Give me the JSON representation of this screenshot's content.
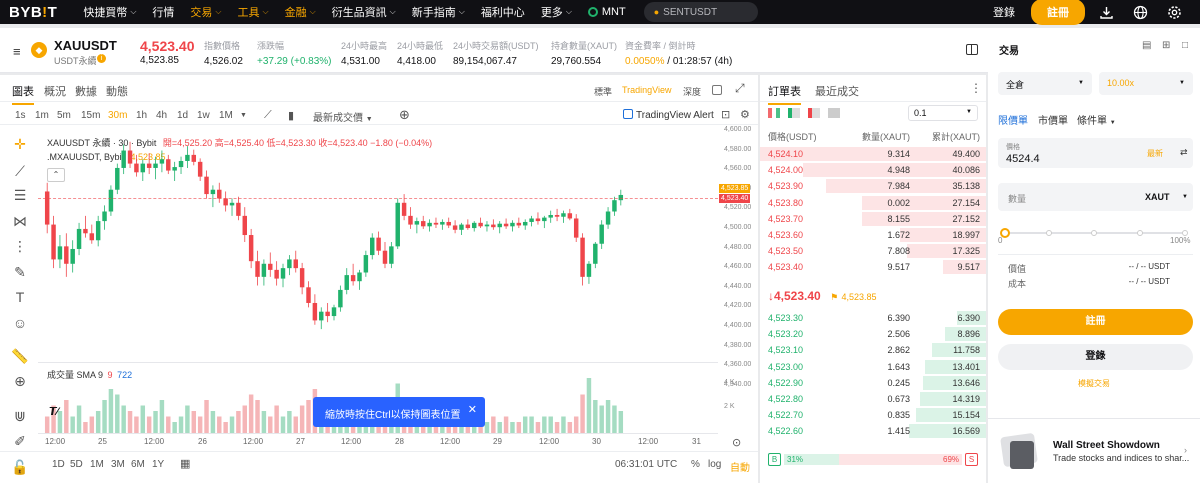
{
  "nav": {
    "logo_a": "BYB",
    "logo_b": "!",
    "logo_c": "T",
    "items": [
      {
        "label": "快捷買幣",
        "caret": true,
        "orange": false
      },
      {
        "label": "行情",
        "caret": false,
        "orange": false
      },
      {
        "label": "交易",
        "caret": true,
        "orange": true
      },
      {
        "label": "工具",
        "caret": true,
        "orange": true
      },
      {
        "label": "金融",
        "caret": true,
        "orange": true
      },
      {
        "label": "衍生品資訊",
        "caret": true,
        "orange": false
      },
      {
        "label": "新手指南",
        "caret": true,
        "orange": false
      },
      {
        "label": "福利中心",
        "caret": false,
        "orange": false
      },
      {
        "label": "更多",
        "caret": true,
        "orange": false
      },
      {
        "label": "MNT",
        "caret": false,
        "orange": false
      }
    ],
    "search_placeholder": "SENTUSDT",
    "login": "登錄",
    "register": "註冊"
  },
  "ticker": {
    "symbol": "XAUUSDT",
    "sub": "USDT永續",
    "last": "4,523.40",
    "last_sub": "4,523.85",
    "stats": [
      {
        "label": "指數價格",
        "value": "4,526.02",
        "color": "#121214"
      },
      {
        "label": "漲跌幅",
        "value": "+37.29 (+0.83%)",
        "color": "#20b26c"
      },
      {
        "label": "24小時最高",
        "value": "4,531.00",
        "color": "#121214"
      },
      {
        "label": "24小時最低",
        "value": "4,418.00",
        "color": "#121214"
      },
      {
        "label": "24小時交易額(USDT)",
        "value": "89,154,067.47",
        "color": "#121214"
      },
      {
        "label": "持倉數量(XAUT)",
        "value": "29,760.554",
        "color": "#121214"
      }
    ],
    "funding_label": "資金費率 / 倒計時",
    "funding_rate": "0.0050%",
    "funding_countdown": " / 01:28:57 (4h)"
  },
  "chart": {
    "tabs": [
      "圖表",
      "概況",
      "數據",
      "動態"
    ],
    "modes": [
      "標準",
      "TradingView",
      "深度"
    ],
    "timeframes": [
      "1s",
      "1m",
      "5m",
      "15m",
      "30m",
      "1h",
      "4h",
      "1d",
      "1w",
      "1M"
    ],
    "indicators": "最新成交價",
    "alert": "TradingView Alert",
    "legend_title": "XAUUSDT 永續 · 30 · Bybit",
    "legend_o": "開=4,525.20",
    "legend_h": "高=4,525.40",
    "legend_l": "低=4,523.30",
    "legend_c": "收=4,523.40",
    "legend_chg": "−1.80 (−0.04%)",
    "legend2": ".MXAUUSDT, Bybit",
    "legend2_val": "4,523.85",
    "vol_label": "成交量 SMA 9",
    "vol_a": "9",
    "vol_b": "722",
    "tooltip": "縮放時按住Ctrl以保持圖表位置",
    "price_tag_1": "4,523.85",
    "price_tag_2": "4,523.40",
    "y_ticks": [
      "4,600.00",
      "4,580.00",
      "4,560.00",
      "4,540.00",
      "4,520.00",
      "4,500.00",
      "4,480.00",
      "4,460.00",
      "4,440.00",
      "4,420.00",
      "4,400.00",
      "4,380.00",
      "4,360.00",
      "4,340.00"
    ],
    "vol_ticks": [
      "4 K",
      "2 K"
    ],
    "x_ticks": [
      "12:00",
      "25",
      "12:00",
      "26",
      "12:00",
      "27",
      "12:00",
      "28",
      "12:00",
      "29",
      "12:00",
      "30",
      "12:00",
      "31"
    ],
    "ranges": [
      "1D",
      "5D",
      "1M",
      "3M",
      "6M",
      "1Y"
    ],
    "clock": "06:31:01 UTC",
    "pct": "%",
    "log": "log",
    "auto": "自動"
  },
  "orderbook": {
    "tabs": [
      "訂單表",
      "最近成交"
    ],
    "step": "0.1",
    "h_price": "價格(USDT)",
    "h_qty": "數量(XAUT)",
    "h_total": "累計(XAUT)",
    "asks": [
      {
        "p": "4,524.10",
        "q": "9.314",
        "t": "49.400",
        "d": 1.0
      },
      {
        "p": "4,524.00",
        "q": "4.948",
        "t": "40.086",
        "d": 0.81
      },
      {
        "p": "4,523.90",
        "q": "7.984",
        "t": "35.138",
        "d": 0.71
      },
      {
        "p": "4,523.80",
        "q": "0.002",
        "t": "27.154",
        "d": 0.55
      },
      {
        "p": "4,523.70",
        "q": "8.155",
        "t": "27.152",
        "d": 0.55
      },
      {
        "p": "4,523.60",
        "q": "1.672",
        "t": "18.997",
        "d": 0.38
      },
      {
        "p": "4,523.50",
        "q": "7.808",
        "t": "17.325",
        "d": 0.35
      },
      {
        "p": "4,523.40",
        "q": "9.517",
        "t": "9.517",
        "d": 0.19
      }
    ],
    "mid": "↓4,523.40",
    "mid_mark": "4,523.85",
    "bids": [
      {
        "p": "4,523.30",
        "q": "6.390",
        "t": "6.390",
        "d": 0.13
      },
      {
        "p": "4,523.20",
        "q": "2.506",
        "t": "8.896",
        "d": 0.18
      },
      {
        "p": "4,523.10",
        "q": "2.862",
        "t": "11.758",
        "d": 0.24
      },
      {
        "p": "4,523.00",
        "q": "1.643",
        "t": "13.401",
        "d": 0.27
      },
      {
        "p": "4,522.90",
        "q": "0.245",
        "t": "13.646",
        "d": 0.28
      },
      {
        "p": "4,522.80",
        "q": "0.673",
        "t": "14.319",
        "d": 0.29
      },
      {
        "p": "4,522.70",
        "q": "0.835",
        "t": "15.154",
        "d": 0.31
      },
      {
        "p": "4,522.60",
        "q": "1.415",
        "t": "16.569",
        "d": 0.34
      }
    ],
    "buy_pct": "31%",
    "sell_pct": "69%",
    "buy_ratio": 0.31,
    "b": "B",
    "s": "S"
  },
  "trade": {
    "title": "交易",
    "margin": "全倉",
    "leverage": "10.00x",
    "types": [
      "限價單",
      "市價單",
      "條件單"
    ],
    "price_label": "價格",
    "price_value": "4524.4",
    "latest": "最新",
    "qty_label": "數量",
    "qty_unit": "XAUT",
    "slider_min": "0",
    "slider_max": "100%",
    "row1_label": "價值",
    "row2_label": "成本",
    "row_value": "-- / -- USDT",
    "register": "註冊",
    "login": "登錄",
    "demo": "模擬交易"
  },
  "promo": {
    "title": "Wall Street Showdown",
    "desc": "Trade stocks and indices to shar..."
  },
  "candles": [
    [
      4528,
      4538,
      4480,
      4490
    ],
    [
      4490,
      4500,
      4440,
      4450
    ],
    [
      4450,
      4478,
      4440,
      4465
    ],
    [
      4465,
      4480,
      4430,
      4445
    ],
    [
      4445,
      4472,
      4435,
      4462
    ],
    [
      4462,
      4492,
      4455,
      4485
    ],
    [
      4485,
      4500,
      4475,
      4480
    ],
    [
      4480,
      4490,
      4468,
      4472
    ],
    [
      4472,
      4500,
      4465,
      4494
    ],
    [
      4494,
      4512,
      4484,
      4505
    ],
    [
      4505,
      4535,
      4500,
      4530
    ],
    [
      4530,
      4560,
      4525,
      4555
    ],
    [
      4555,
      4582,
      4548,
      4575
    ],
    [
      4575,
      4585,
      4555,
      4560
    ],
    [
      4560,
      4570,
      4545,
      4550
    ],
    [
      4550,
      4565,
      4540,
      4560
    ],
    [
      4560,
      4572,
      4548,
      4555
    ],
    [
      4555,
      4568,
      4542,
      4560
    ],
    [
      4560,
      4575,
      4550,
      4565
    ],
    [
      4565,
      4570,
      4548,
      4552
    ],
    [
      4552,
      4562,
      4540,
      4556
    ],
    [
      4556,
      4568,
      4548,
      4563
    ],
    [
      4563,
      4580,
      4555,
      4570
    ],
    [
      4570,
      4576,
      4558,
      4562
    ],
    [
      4562,
      4566,
      4540,
      4545
    ],
    [
      4545,
      4552,
      4520,
      4525
    ],
    [
      4525,
      4535,
      4510,
      4530
    ],
    [
      4530,
      4538,
      4515,
      4520
    ],
    [
      4520,
      4528,
      4505,
      4512
    ],
    [
      4512,
      4520,
      4500,
      4515
    ],
    [
      4515,
      4522,
      4495,
      4500
    ],
    [
      4500,
      4510,
      4470,
      4478
    ],
    [
      4478,
      4485,
      4440,
      4448
    ],
    [
      4448,
      4460,
      4420,
      4430
    ],
    [
      4430,
      4450,
      4420,
      4445
    ],
    [
      4445,
      4458,
      4430,
      4438
    ],
    [
      4438,
      4448,
      4420,
      4428
    ],
    [
      4428,
      4445,
      4418,
      4440
    ],
    [
      4440,
      4455,
      4432,
      4450
    ],
    [
      4450,
      4460,
      4435,
      4440
    ],
    [
      4440,
      4446,
      4410,
      4418
    ],
    [
      4418,
      4425,
      4395,
      4400
    ],
    [
      4400,
      4410,
      4375,
      4380
    ],
    [
      4380,
      4395,
      4370,
      4390
    ],
    [
      4390,
      4400,
      4378,
      4385
    ],
    [
      4385,
      4398,
      4380,
      4395
    ],
    [
      4395,
      4420,
      4390,
      4415
    ],
    [
      4415,
      4440,
      4410,
      4432
    ],
    [
      4432,
      4445,
      4420,
      4425
    ],
    [
      4425,
      4438,
      4415,
      4435
    ],
    [
      4435,
      4460,
      4430,
      4455
    ],
    [
      4455,
      4480,
      4450,
      4475
    ],
    [
      4475,
      4482,
      4455,
      4460
    ],
    [
      4460,
      4470,
      4440,
      4445
    ],
    [
      4445,
      4470,
      4440,
      4465
    ],
    [
      4465,
      4520,
      4462,
      4515
    ],
    [
      4515,
      4525,
      4495,
      4500
    ],
    [
      4500,
      4510,
      4485,
      4490
    ],
    [
      4490,
      4498,
      4480,
      4494
    ],
    [
      4494,
      4500,
      4485,
      4488
    ],
    [
      4488,
      4496,
      4482,
      4492
    ],
    [
      4492,
      4498,
      4486,
      4490
    ],
    [
      4490,
      4496,
      4484,
      4493
    ],
    [
      4493,
      4498,
      4486,
      4489
    ],
    [
      4489,
      4495,
      4480,
      4484
    ],
    [
      4484,
      4492,
      4478,
      4490
    ],
    [
      4490,
      4496,
      4484,
      4486
    ],
    [
      4486,
      4494,
      4482,
      4492
    ],
    [
      4492,
      4498,
      4486,
      4488
    ],
    [
      4488,
      4494,
      4482,
      4490
    ],
    [
      4490,
      4496,
      4484,
      4487
    ],
    [
      4487,
      4494,
      4480,
      4491
    ],
    [
      4491,
      4497,
      4485,
      4488
    ],
    [
      4488,
      4495,
      4482,
      4492
    ],
    [
      4492,
      4498,
      4486,
      4489
    ],
    [
      4489,
      4496,
      4484,
      4493
    ],
    [
      4493,
      4500,
      4488,
      4497
    ],
    [
      4497,
      4504,
      4490,
      4494
    ],
    [
      4494,
      4500,
      4486,
      4498
    ],
    [
      4498,
      4506,
      4492,
      4501
    ],
    [
      4501,
      4508,
      4494,
      4499
    ],
    [
      4499,
      4506,
      4492,
      4503
    ],
    [
      4503,
      4508,
      4495,
      4497
    ],
    [
      4497,
      4502,
      4470,
      4475
    ],
    [
      4475,
      4480,
      4420,
      4430
    ],
    [
      4430,
      4448,
      4422,
      4445
    ],
    [
      4445,
      4470,
      4440,
      4468
    ],
    [
      4468,
      4495,
      4462,
      4490
    ],
    [
      4490,
      4510,
      4485,
      4505
    ],
    [
      4505,
      4522,
      4500,
      4518
    ],
    [
      4518,
      4530,
      4512,
      4524
    ]
  ],
  "volumes": [
    0.3,
    0.5,
    0.4,
    0.6,
    0.3,
    0.5,
    0.2,
    0.3,
    0.4,
    0.6,
    0.8,
    0.7,
    0.5,
    0.4,
    0.3,
    0.5,
    0.3,
    0.4,
    0.6,
    0.3,
    0.2,
    0.3,
    0.5,
    0.4,
    0.3,
    0.6,
    0.4,
    0.3,
    0.2,
    0.3,
    0.4,
    0.5,
    0.7,
    0.6,
    0.4,
    0.3,
    0.5,
    0.3,
    0.4,
    0.3,
    0.5,
    0.6,
    0.8,
    0.4,
    0.3,
    0.3,
    0.5,
    0.6,
    0.3,
    0.3,
    0.4,
    0.5,
    0.3,
    0.4,
    0.6,
    0.9,
    0.5,
    0.3,
    0.2,
    0.2,
    0.2,
    0.3,
    0.2,
    0.2,
    0.3,
    0.2,
    0.2,
    0.3,
    0.2,
    0.2,
    0.3,
    0.2,
    0.3,
    0.2,
    0.2,
    0.3,
    0.3,
    0.2,
    0.3,
    0.3,
    0.2,
    0.3,
    0.2,
    0.3,
    0.7,
    1.0,
    0.6,
    0.5,
    0.6,
    0.5,
    0.4
  ]
}
